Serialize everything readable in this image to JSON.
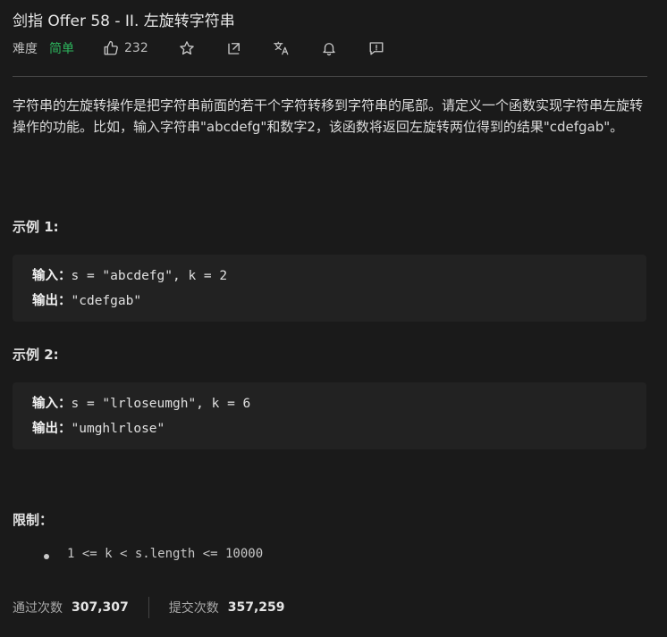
{
  "problem": {
    "title": "剑指 Offer 58 - II. 左旋转字符串",
    "difficulty_label": "难度",
    "difficulty_value": "简单",
    "likes": "232",
    "difficulty_color": "#2db55d"
  },
  "icons": [
    "thumbs-up-icon",
    "star-icon",
    "share-icon",
    "translate-icon",
    "bell-icon",
    "feedback-icon"
  ],
  "description": "字符串的左旋转操作是把字符串前面的若干个字符转移到字符串的尾部。请定义一个函数实现字符串左旋转操作的功能。比如，输入字符串\"abcdefg\"和数字2，该函数将返回左旋转两位得到的结果\"cdefgab\"。",
  "examples": [
    {
      "title": "示例 1:",
      "input_label": "输入：",
      "input_value": "s = \"abcdefg\", k = 2",
      "output_label": "输出：",
      "output_value": "\"cdefgab\""
    },
    {
      "title": "示例 2:",
      "input_label": "输入：",
      "input_value": "s = \"lrloseumgh\", k = 6",
      "output_label": "输出：",
      "output_value": "\"umghlrlose\""
    }
  ],
  "constraints": {
    "title": "限制：",
    "items": [
      "1 <= k < s.length <= 10000"
    ]
  },
  "stats": {
    "accepted_label": "通过次数",
    "accepted_value": "307,307",
    "submitted_label": "提交次数",
    "submitted_value": "357,259"
  }
}
